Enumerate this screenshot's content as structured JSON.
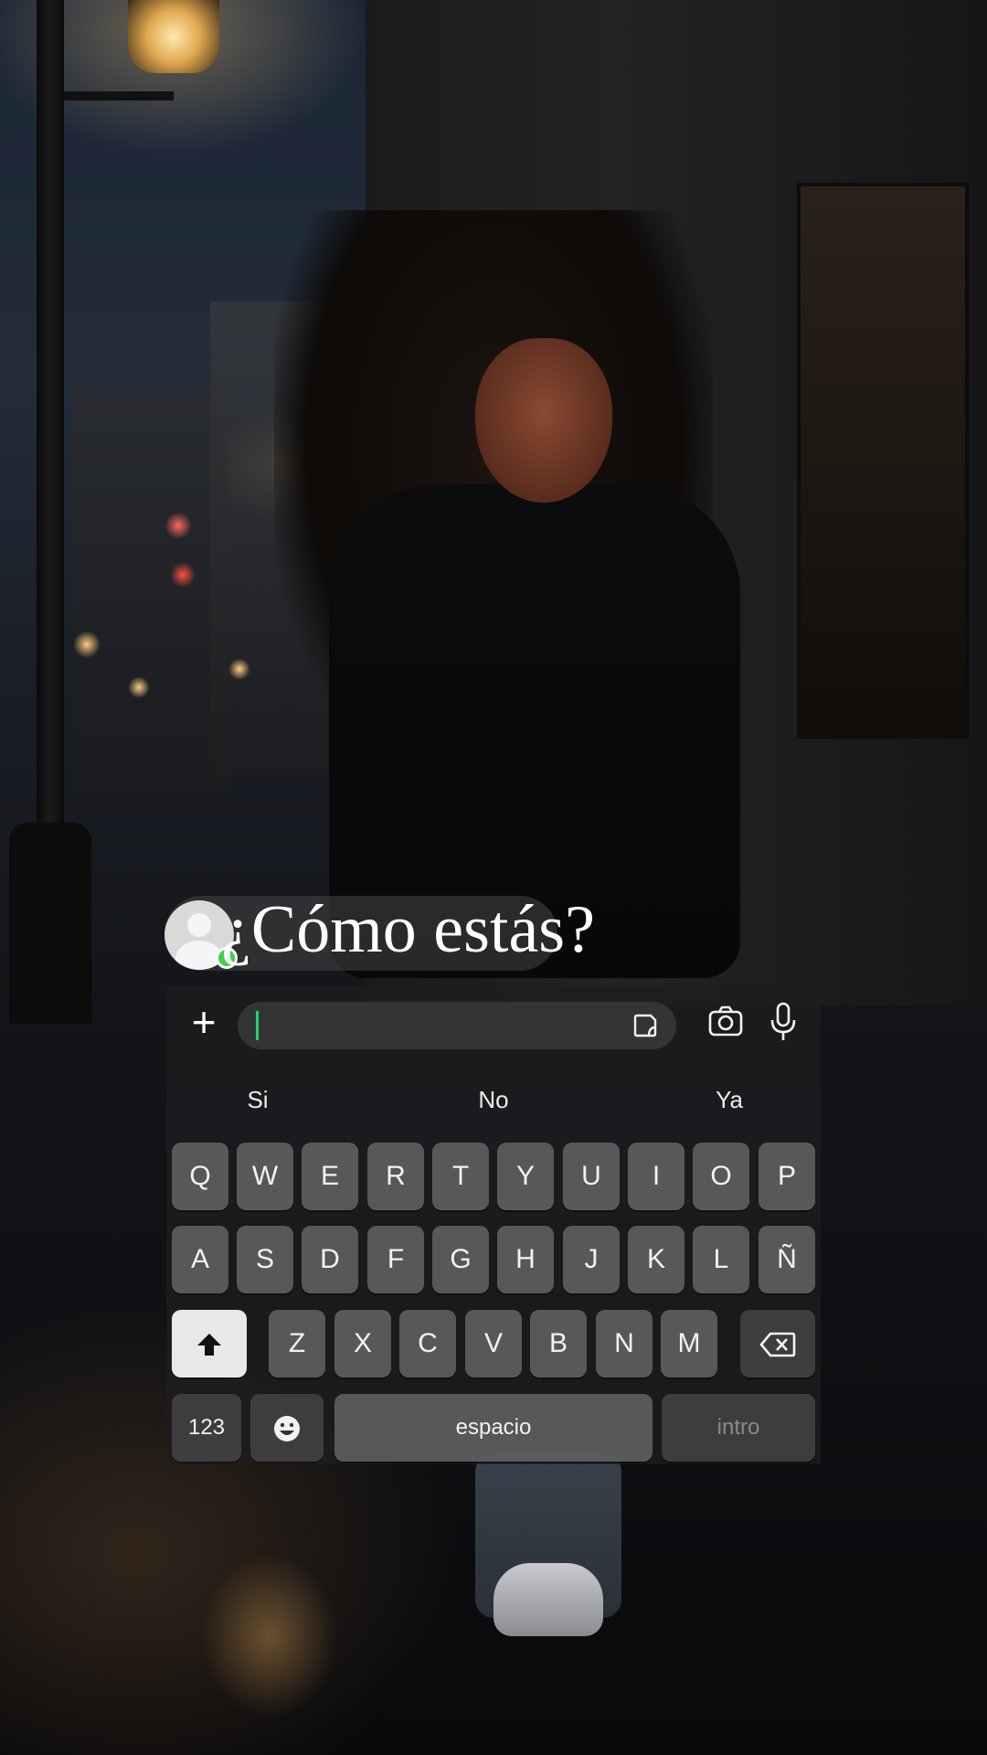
{
  "caption": {
    "text": "¿Cómo estás?",
    "avatar_icon": "user-avatar-icon",
    "status_color": "#3fd14c"
  },
  "input_bar": {
    "add_label": "+",
    "cursor_color": "#25d366",
    "sticker_icon": "sticker-icon",
    "camera_icon": "camera-icon",
    "mic_icon": "microphone-icon"
  },
  "suggestions": [
    "Si",
    "No",
    "Ya"
  ],
  "keyboard": {
    "row1": [
      "Q",
      "W",
      "E",
      "R",
      "T",
      "Y",
      "U",
      "I",
      "O",
      "P"
    ],
    "row2": [
      "A",
      "S",
      "D",
      "F",
      "G",
      "H",
      "J",
      "K",
      "L",
      "Ñ"
    ],
    "row3": [
      "Z",
      "X",
      "C",
      "V",
      "B",
      "N",
      "M"
    ],
    "shift_icon": "shift-arrow-icon",
    "backspace_icon": "backspace-icon",
    "numbers_label": "123",
    "emoji_icon": "emoji-icon",
    "space_label": "espacio",
    "enter_label": "intro"
  }
}
